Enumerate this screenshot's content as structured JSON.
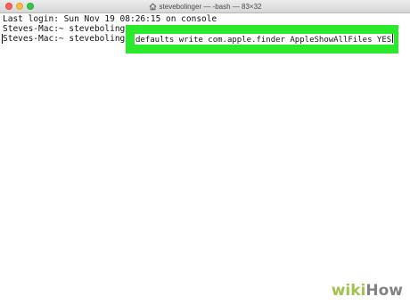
{
  "window": {
    "title": "stevebolinger — -bash — 83×32",
    "title_icon": "home-icon"
  },
  "terminal": {
    "last_login": "Last login: Sun Nov 19 08:26:15 on console",
    "prompt_line_1": "Steves-Mac:~ stevebolinger$",
    "prompt_line_2": "Steves-Mac:~ stevebolinger$",
    "command": "defaults write com.apple.finder AppleShowAllFiles YES"
  },
  "watermark": {
    "wiki": "wiki",
    "how": "How"
  },
  "colors": {
    "highlight": "#2bea2b",
    "close": "#fc605c",
    "minimize": "#fdbc40",
    "maximize": "#34c84a",
    "watermark_wiki": "#93b82e",
    "watermark_how": "#6e6e6e"
  }
}
